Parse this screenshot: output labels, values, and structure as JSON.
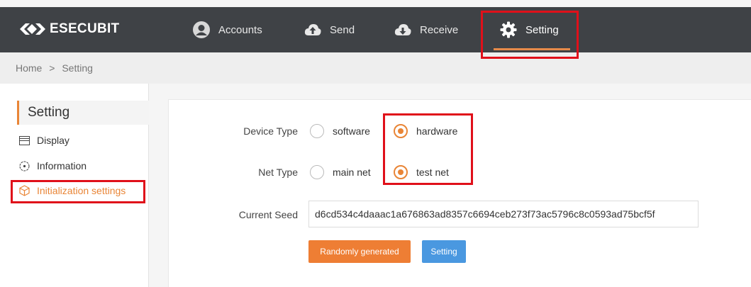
{
  "header": {
    "logo_text": "ESECUBIT",
    "nav": {
      "accounts": "Accounts",
      "send": "Send",
      "receive": "Receive",
      "setting": "Setting"
    }
  },
  "breadcrumb": {
    "home": "Home",
    "separator": ">",
    "current": "Setting"
  },
  "sidebar": {
    "title": "Setting",
    "items": {
      "display": "Display",
      "information": "Information",
      "initialization": "Initialization settings"
    }
  },
  "form": {
    "device_type": {
      "label": "Device Type",
      "options": [
        "software",
        "hardware"
      ],
      "selected": "hardware"
    },
    "net_type": {
      "label": "Net Type",
      "options": [
        "main net",
        "test net"
      ],
      "selected": "test net"
    },
    "seed": {
      "label": "Current Seed",
      "value": "d6cd534c4daaac1a676863ad8357c6694ceb273f73ac5796c8c0593ad75bcf5f"
    },
    "buttons": {
      "random": "Randomly generated",
      "setting": "Setting"
    }
  },
  "colors": {
    "accent": "#e98536",
    "topbar": "#3f4246",
    "primary_button": "#4a98e0",
    "highlight": "#e0101a"
  }
}
